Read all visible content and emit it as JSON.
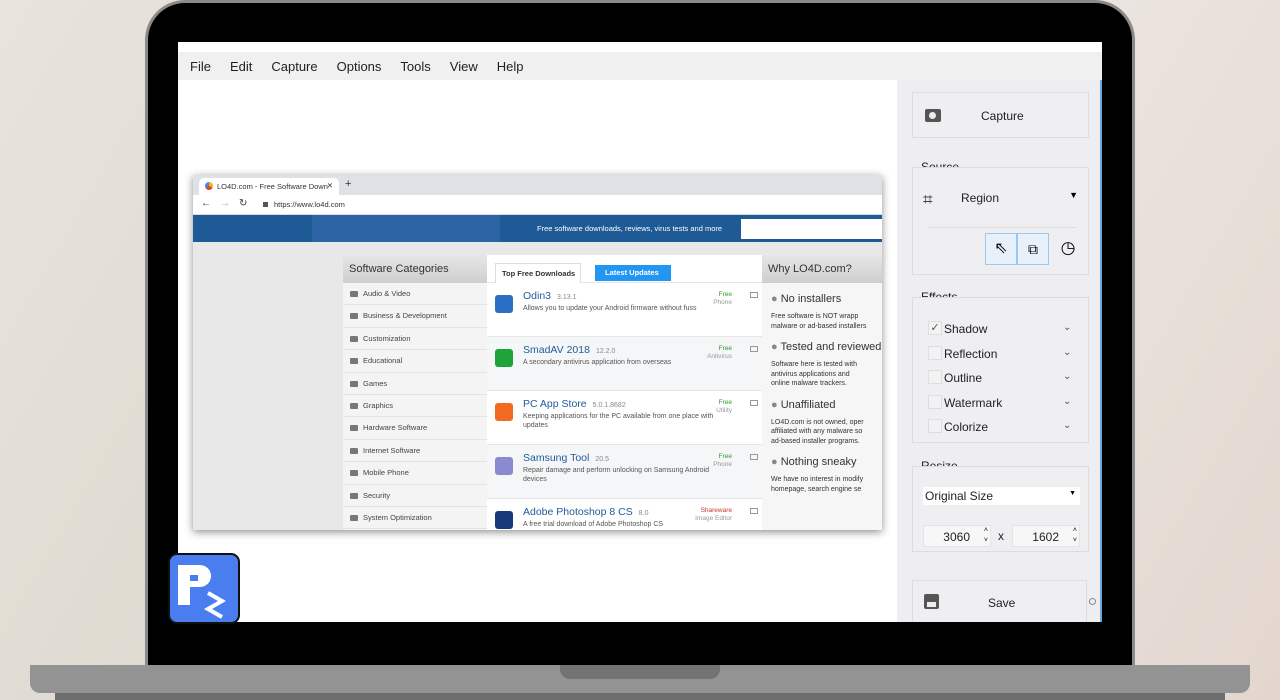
{
  "menu": [
    "File",
    "Edit",
    "Capture",
    "Options",
    "Tools",
    "View",
    "Help"
  ],
  "panel": {
    "capture_label": "Capture",
    "source_label": "Source",
    "source_value": "Region",
    "effects_label": "Effects",
    "effects": [
      {
        "label": "Shadow",
        "checked": true
      },
      {
        "label": "Reflection",
        "checked": false
      },
      {
        "label": "Outline",
        "checked": false
      },
      {
        "label": "Watermark",
        "checked": false
      },
      {
        "label": "Colorize",
        "checked": false
      }
    ],
    "resize_label": "Resize",
    "resize_value": "Original Size",
    "width": "3060",
    "height": "1602",
    "times": "x",
    "save_label": "Save"
  },
  "shot": {
    "tab_title": "LO4D.com - Free Software Down",
    "url": "https://www.lo4d.com",
    "banner_text": "Free software downloads, reviews, virus tests and more",
    "categories_title": "Software Categories",
    "categories": [
      "Audio & Video",
      "Business & Development",
      "Customization",
      "Educational",
      "Games",
      "Graphics",
      "Hardware Software",
      "Internet Software",
      "Mobile Phone",
      "Security",
      "System Optimization"
    ],
    "tab_top": "Top Free Downloads",
    "tab_latest": "Latest Updates",
    "downloads": [
      {
        "name": "Odin3",
        "version": "3.13.1",
        "desc": "Allows you to update your Android firmware without fuss",
        "license": "Free",
        "type": "Phone",
        "color": "#2a6fc4"
      },
      {
        "name": "SmadAV 2018",
        "version": "12.2.0",
        "desc": "A secondary antivirus application from overseas",
        "license": "Free",
        "type": "Antivirus",
        "color": "#1ea33a"
      },
      {
        "name": "PC App Store",
        "version": "5.0.1.8682",
        "desc": "Keeping applications for the PC available from one place with updates",
        "license": "Free",
        "type": "Utility",
        "color": "#f26a22"
      },
      {
        "name": "Samsung Tool",
        "version": "20.5",
        "desc": "Repair damage and perform unlocking on Samsung Android devices",
        "license": "Free",
        "type": "Phone",
        "color": "#8a8ad0"
      },
      {
        "name": "Adobe Photoshop 8 CS",
        "version": "8.0",
        "desc": "A free trial download of Adobe Photoshop CS",
        "license": "Shareware",
        "type": "Image Editor",
        "color": "#163a7a"
      }
    ],
    "why_title": "Why LO4D.com?",
    "why": [
      {
        "title": "No installers",
        "text": [
          "Free software is NOT wrapp",
          "malware or ad-based installers"
        ]
      },
      {
        "title": "Tested and reviewed",
        "text": [
          "Software here is tested with",
          "antivirus applications and",
          "online malware trackers."
        ]
      },
      {
        "title": "Unaffiliated",
        "text": [
          "LO4D.com is not owned, oper",
          "affiliated with any malware so",
          "ad-based installer programs."
        ]
      },
      {
        "title": "Nothing sneaky",
        "text": [
          "We have no interest in modify",
          "homepage, search engine se"
        ]
      }
    ]
  },
  "colors": {
    "accent": "#4a7ef0",
    "banner": "#1d5a96",
    "tab_active": "#2196f3"
  }
}
